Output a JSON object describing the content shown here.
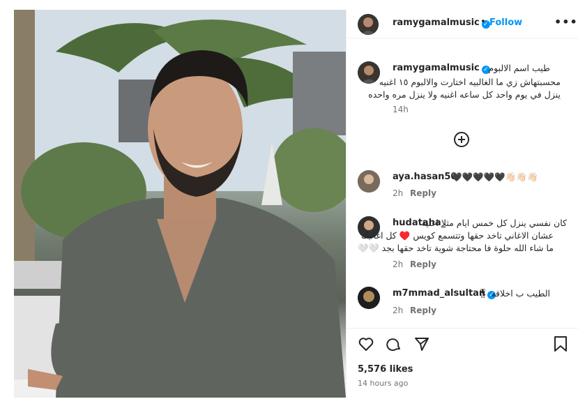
{
  "post": {
    "image_alt": "Smiling man with beard sitting outdoors at a cafe",
    "likes": "5,576 likes",
    "time": "14 hours ago"
  },
  "header": {
    "username": "ramygamalmusic",
    "separator": "•",
    "follow_label": "Follow",
    "more_label": "•••"
  },
  "caption": {
    "username": "ramygamalmusic",
    "line1": "طيب اسم الالبوم",
    "line2": "محسبتهاش زي ما الغالبيه اختارت والالبوم ١٥ اغنيه",
    "line3": "ينزل في يوم واحد كل ساعه اغنيه ولا ينزل مره واحده",
    "time": "14h"
  },
  "comments": [
    {
      "username": "aya.hasan50",
      "text": "🖤🖤🖤🖤🖤👋🏻👋🏻👋🏻",
      "time": "2h",
      "reply": "Reply"
    },
    {
      "username": "hudataha_",
      "text_lines": [
        "كان نفسي ينزل كل خمس ايام مثلا اغنية",
        "عشان الاغاني تاخد حقها وتتسمع كويس ♥️ كل اغانيك",
        "ما شاء الله حلوة فا محتاجة شوية تاخد حقها بجد 🤍🤍"
      ],
      "time": "2h",
      "reply": "Reply"
    },
    {
      "username": "m7mmad_alsultan",
      "text": "الطيب ب اخلاقه 🎖",
      "time": "2h",
      "reply": "Reply"
    }
  ],
  "icons": [
    "heart-icon",
    "comment-icon",
    "share-icon",
    "save-icon",
    "add-comment-icon",
    "verified-icon"
  ],
  "colors": {
    "link": "#0095f6",
    "muted": "#737373",
    "text": "#262626"
  }
}
